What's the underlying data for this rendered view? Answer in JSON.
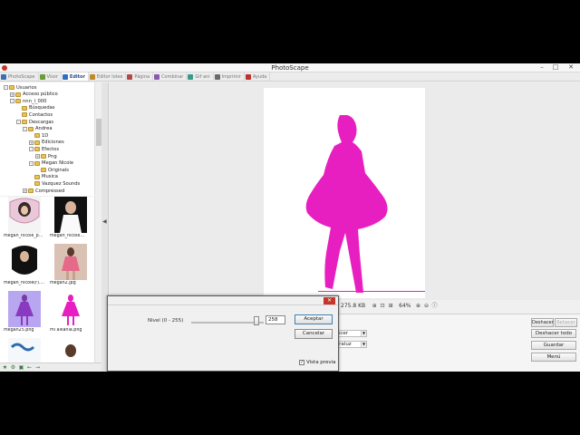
{
  "window": {
    "title": "PhotoScape"
  },
  "tabs": [
    {
      "label": "PhotoScape",
      "color": "#3b6fb5",
      "active": false
    },
    {
      "label": "Visor",
      "color": "#6a9a3a",
      "active": false
    },
    {
      "label": "Editor",
      "color": "#2f6fc0",
      "active": true
    },
    {
      "label": "Editor lotes",
      "color": "#c08a2a",
      "active": false
    },
    {
      "label": "Página",
      "color": "#b04a4a",
      "active": false
    },
    {
      "label": "Combinar",
      "color": "#8a5ab0",
      "active": false
    },
    {
      "label": "Gif ani",
      "color": "#3a9a8a",
      "active": false
    },
    {
      "label": "Imprimir",
      "color": "#6a6a6a",
      "active": false
    },
    {
      "label": "Ayuda",
      "color": "#c03030",
      "active": false
    }
  ],
  "tree": {
    "items": [
      {
        "label": "Usuarios",
        "level": 0,
        "expander": "-"
      },
      {
        "label": "Acceso público",
        "level": 1,
        "expander": "+"
      },
      {
        "label": "nnn_l_000",
        "level": 1,
        "expander": "-"
      },
      {
        "label": "Búsquedas",
        "level": 2,
        "expander": ""
      },
      {
        "label": "Contactos",
        "level": 2,
        "expander": ""
      },
      {
        "label": "Descargas",
        "level": 2,
        "expander": "-"
      },
      {
        "label": "Andrea",
        "level": 3,
        "expander": "-"
      },
      {
        "label": "1D",
        "level": 4,
        "expander": ""
      },
      {
        "label": "Ediciones",
        "level": 4,
        "expander": "+"
      },
      {
        "label": "Efectos",
        "level": 4,
        "expander": "-"
      },
      {
        "label": "Png",
        "level": 5,
        "expander": "+"
      },
      {
        "label": "Megan Nicole",
        "level": 4,
        "expander": "-"
      },
      {
        "label": "Originals",
        "level": 5,
        "expander": ""
      },
      {
        "label": "Musica",
        "level": 4,
        "expander": ""
      },
      {
        "label": "Vazquez Sounds",
        "level": 4,
        "expander": ""
      },
      {
        "label": "Compressed",
        "level": 3,
        "expander": "+"
      }
    ]
  },
  "thumbnails": [
    {
      "label": "megan_nicole_p..."
    },
    {
      "label": "megan_nicole..."
    },
    {
      "label": "megan_nicole(r)...."
    },
    {
      "label": "megan2.jpg"
    },
    {
      "label": "megan25.png"
    },
    {
      "label": "mi alkania.png"
    }
  ],
  "status": {
    "file_size": "275.8 KB",
    "zoom": "64%"
  },
  "dialog": {
    "close_glyph": "✕",
    "level_label": "Nivel (0 - 255)",
    "level_value": "258",
    "level_fraction": 0.9,
    "accept_label": "Aceptar",
    "cancel_label": "Cancelar",
    "preview_label": "Vista previa",
    "preview_checked": true
  },
  "panel": {
    "combo1_text": "ecer",
    "combo2_text": "traluz",
    "undo_label": "Deshacer",
    "redo_label": "Rehacer",
    "undo_all_label": "Deshacer todo",
    "save_label": "Guardar",
    "menu_label": "Menú"
  },
  "colors": {
    "silhouette": "#e81fc0",
    "accent": "#3c7fb1"
  }
}
